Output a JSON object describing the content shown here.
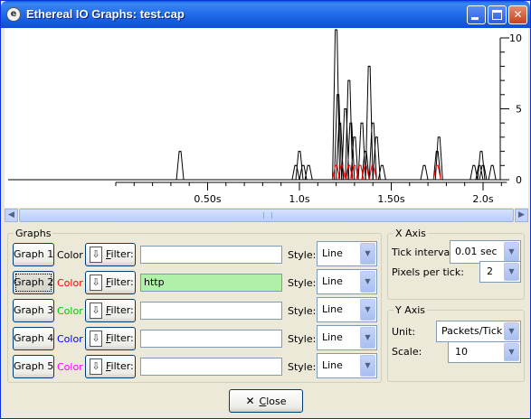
{
  "window": {
    "title": "Ethereal IO Graphs: test.cap"
  },
  "chart_data": {
    "type": "line",
    "x_tick_labels": [
      "0.50s",
      "1.0s",
      "1.50s",
      "2.0s"
    ],
    "x_ticks": [
      0.5,
      1.0,
      1.5,
      2.0
    ],
    "y_tick_labels": [
      "10",
      "5",
      "0"
    ],
    "y_ticks": [
      10,
      5,
      0
    ],
    "ylim": [
      0,
      10
    ],
    "xlim": [
      0.0,
      2.1
    ],
    "series": [
      {
        "color": "#000000",
        "points": [
          [
            0.35,
            2
          ],
          [
            0.98,
            1
          ],
          [
            1.0,
            2
          ],
          [
            1.02,
            1
          ],
          [
            1.05,
            1
          ],
          [
            1.2,
            12
          ],
          [
            1.21,
            6
          ],
          [
            1.22,
            4
          ],
          [
            1.25,
            5
          ],
          [
            1.27,
            7
          ],
          [
            1.28,
            4
          ],
          [
            1.3,
            3
          ],
          [
            1.34,
            4
          ],
          [
            1.36,
            2
          ],
          [
            1.38,
            8
          ],
          [
            1.4,
            4
          ],
          [
            1.42,
            3
          ],
          [
            1.45,
            1
          ],
          [
            1.68,
            1
          ],
          [
            1.75,
            2
          ],
          [
            1.76,
            3
          ],
          [
            1.95,
            1
          ],
          [
            1.98,
            1
          ],
          [
            1.99,
            2
          ],
          [
            2.0,
            1
          ],
          [
            2.05,
            1
          ]
        ]
      },
      {
        "color": "#FF0000",
        "points": [
          [
            1.2,
            1
          ],
          [
            1.23,
            1
          ],
          [
            1.27,
            1
          ],
          [
            1.3,
            1
          ],
          [
            1.33,
            1
          ],
          [
            1.36,
            1
          ],
          [
            1.4,
            1
          ],
          [
            1.75,
            1
          ]
        ]
      }
    ]
  },
  "graphs_panel": {
    "legend": "Graphs",
    "color_label": "Color",
    "filter_prefix": "F",
    "filter_rest": "ilter:",
    "style_label": "Style:",
    "rows": [
      {
        "button": "Graph 1",
        "color": "#000000",
        "filter": "",
        "style": "Line"
      },
      {
        "button": "Graph 2",
        "color": "#FF0000",
        "filter": "http",
        "style": "Line"
      },
      {
        "button": "Graph 3",
        "color": "#00C800",
        "filter": "",
        "style": "Line"
      },
      {
        "button": "Graph 4",
        "color": "#0000FF",
        "filter": "",
        "style": "Line"
      },
      {
        "button": "Graph 5",
        "color": "#FF00FF",
        "filter": "",
        "style": "Line"
      }
    ]
  },
  "x_axis": {
    "legend": "X Axis",
    "tick_interval_label": "Tick interval:",
    "tick_interval_value": "0.01 sec",
    "pixels_per_tick_label": "Pixels per tick:",
    "pixels_per_tick_value": "2"
  },
  "y_axis": {
    "legend": "Y Axis",
    "unit_label": "Unit:",
    "unit_value": "Packets/Tick",
    "scale_label": "Scale:",
    "scale_value": "10"
  },
  "close": {
    "prefix": "C",
    "rest": "lose"
  },
  "colors": {
    "filter_active_bg": "#B0F0A8"
  }
}
